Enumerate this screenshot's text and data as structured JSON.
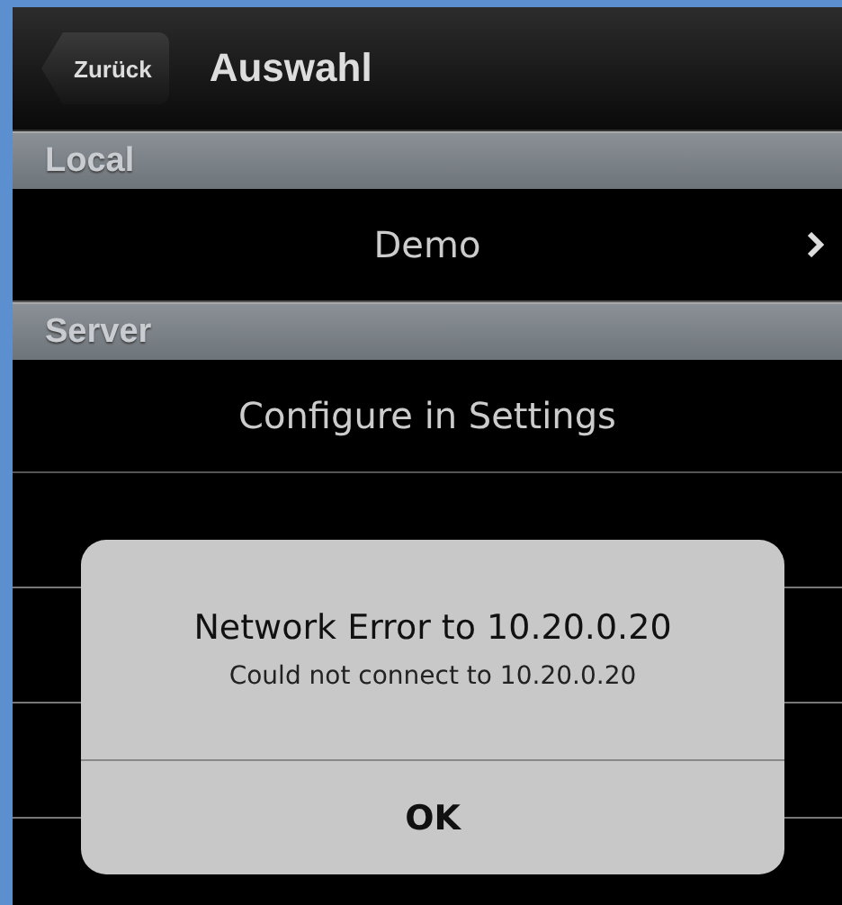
{
  "nav": {
    "back": "Zurück",
    "title": "Auswahl"
  },
  "sections": [
    {
      "header": "Local",
      "rows": [
        {
          "label": "Demo",
          "disclosure": true
        }
      ]
    },
    {
      "header": "Server",
      "rows": [
        {
          "label": "Configure in Settings",
          "disclosure": false
        }
      ]
    }
  ],
  "alert": {
    "title": "Network Error to 10.20.0.20",
    "message": "Could not connect to 10.20.0.20",
    "buttons": [
      "OK"
    ]
  }
}
